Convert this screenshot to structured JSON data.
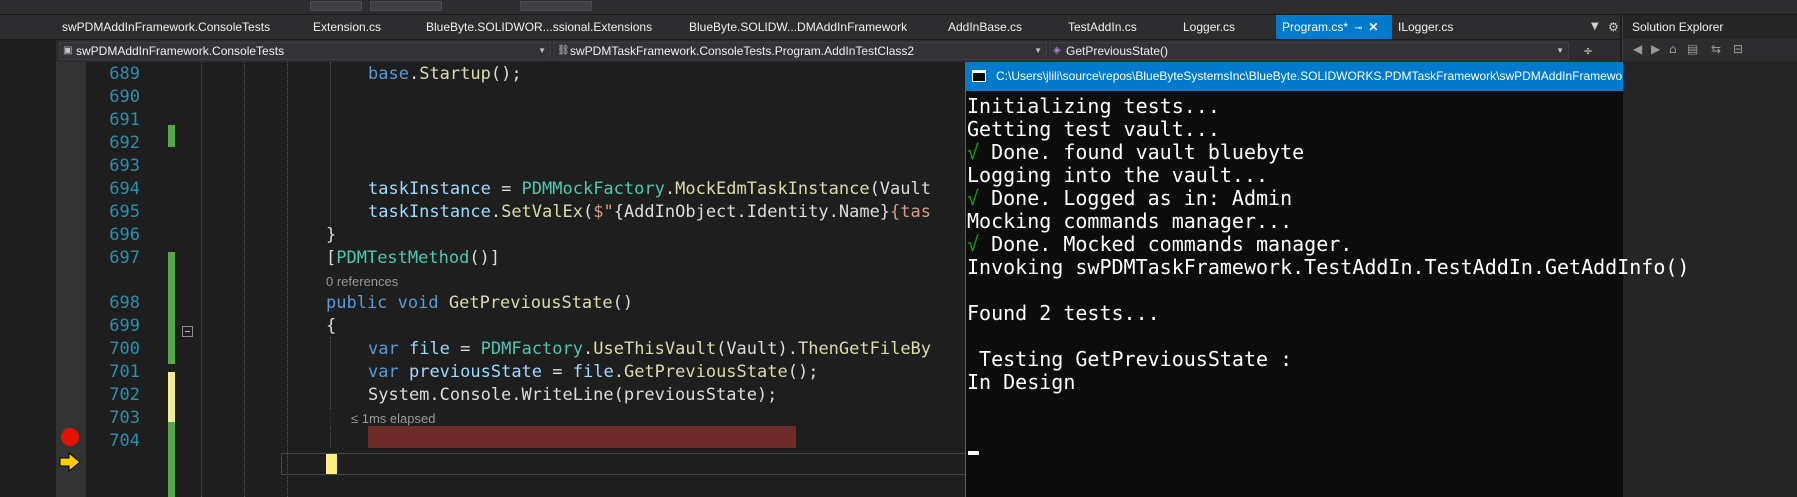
{
  "tabs": [
    {
      "label": "swPDMAddInFramework.ConsoleTests",
      "active": false
    },
    {
      "label": "Extension.cs",
      "active": false
    },
    {
      "label": "BlueByte.SOLIDWOR...ssional.Extensions",
      "active": false
    },
    {
      "label": "BlueByte.SOLIDW...DMAddInFramework",
      "active": false
    },
    {
      "label": "AddInBase.cs",
      "active": false
    },
    {
      "label": "TestAddIn.cs",
      "active": false
    },
    {
      "label": "Logger.cs",
      "active": false
    },
    {
      "label": "Program.cs*",
      "active": true
    },
    {
      "label": "ILogger.cs",
      "active": false
    }
  ],
  "navbar": {
    "project": "swPDMAddInFramework.ConsoleTests",
    "type": "swPDMTaskFramework.ConsoleTests.Program.AddInTestClass2",
    "member": "GetPreviousState()"
  },
  "solution_explorer": {
    "title": "Solution Explorer"
  },
  "editor": {
    "line_numbers": [
      "689",
      "690",
      "691",
      "692",
      "693",
      "694",
      "695",
      "696",
      "697",
      "698",
      "699",
      "700",
      "701",
      "702",
      "703",
      "704"
    ],
    "lens": {
      "references": "0 references",
      "elapsed": "≤ 1ms elapsed"
    },
    "code": {
      "l689": {
        "base": "base",
        "startup": "Startup",
        "tail": "();"
      },
      "l694": {
        "var": "taskInstance",
        "eq": " = ",
        "type": "PDMMockFactory",
        "dot": ".",
        "method": "MockEdmTaskInstance",
        "tail": "(Vault"
      },
      "l695": {
        "var": "taskInstance",
        "dot": ".",
        "method": "SetValEx",
        "open": "(",
        "str": "$\"",
        "mid": "{AddInObject.Identity.Name}",
        "tail": "{tas"
      },
      "l696": {
        "text": "}"
      },
      "l697": {
        "open": "[",
        "attr": "PDMTestMethod",
        "tail": "()]"
      },
      "l698": {
        "kw1": "public",
        "kw2": "void",
        "method": "GetPreviousState",
        "tail": "()"
      },
      "l699": {
        "text": "{"
      },
      "l700": {
        "kw": "var",
        "var": "file",
        "eq": " = ",
        "type": "PDMFactory",
        "dot1": ".",
        "m1": "UseThisVault",
        "arg": "(Vault).",
        "m2": "ThenGetFileBy"
      },
      "l701": {
        "kw": "var",
        "var": "previousState",
        "eq": " = ",
        "obj": "file",
        "dot": ".",
        "method": "GetPreviousState",
        "tail": "();"
      },
      "l702": {
        "text": "System.Console.WriteLine(previousState);"
      },
      "l703": {
        "text": "}"
      }
    }
  },
  "console": {
    "title": "C:\\Users\\jlili\\source\\repos\\BlueByteSystemsInc\\BlueByte.SOLIDWORKS.PDMTaskFramework\\swPDMAddInFramework.ConsoleTests\\bin\\Debug\\swPDMT",
    "check": "√",
    "lines": [
      "Initializing tests...",
      "Getting test vault...",
      " Done. found vault bluebyte",
      "Logging into the vault...",
      " Done. Logged as in: Admin",
      "Mocking commands manager...",
      " Done. Mocked commands manager.",
      "Invoking swPDMTaskFramework.TestAddIn.TestAddIn.GetAddInfo()",
      "Found 2 tests...",
      " Testing GetPreviousState :",
      "In Design"
    ]
  },
  "colors": {
    "accent": "#007acc",
    "breakpoint": "#e51400",
    "exec_arrow": "#ffcc00",
    "check": "#13a10e"
  }
}
